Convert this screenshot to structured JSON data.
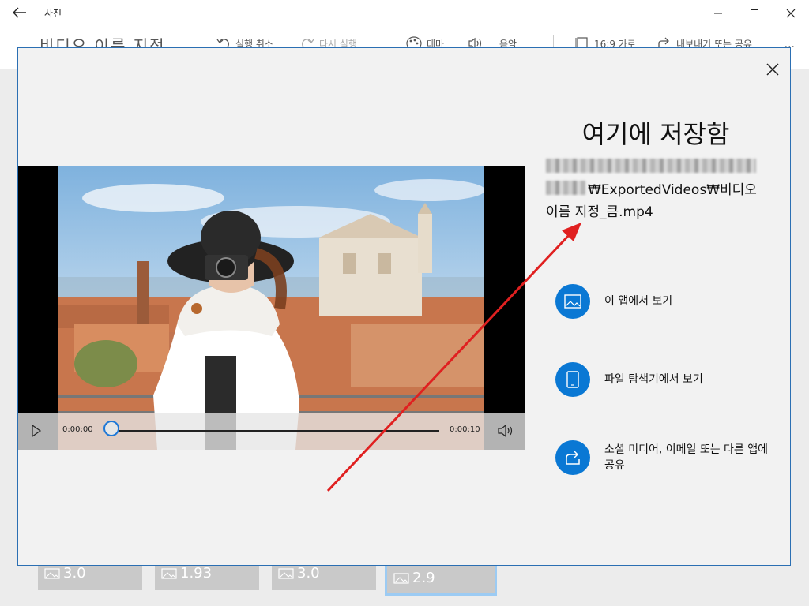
{
  "window": {
    "app_title": "사진",
    "controls": [
      "minimize",
      "maximize",
      "close"
    ]
  },
  "toolbar": {
    "document_title": "비디오 이름 지정",
    "undo_label": "실행 취소",
    "redo_label": "다시 실행",
    "theme_label": "테마",
    "music_label": "음악",
    "aspect_label": "16:9 가로",
    "export_label": "내보내기 또는 공유",
    "more_label": "..."
  },
  "thumbnails": [
    {
      "duration": "3.0",
      "selected": false
    },
    {
      "duration": "1.93",
      "selected": false
    },
    {
      "duration": "3.0",
      "selected": false
    },
    {
      "duration": "2.9",
      "selected": true
    }
  ],
  "dialog": {
    "heading": "여기에 저장함",
    "path_visible_line1": "₩ExportedVideos₩비디오",
    "path_visible_line2": "이름 지정_큼.mp4",
    "player": {
      "current_time": "0:00:00",
      "total_time": "0:00:10",
      "progress": 0.0
    },
    "actions": [
      {
        "label": "이 앱에서 보기",
        "icon": "image-icon"
      },
      {
        "label": "파일 탐색기에서 보기",
        "icon": "tablet-icon"
      },
      {
        "label": "소셜 미디어, 이메일 또는 다른 앱에 공유",
        "icon": "share-icon"
      }
    ]
  },
  "colors": {
    "accent": "#0a78d4",
    "dialog_bg": "#f2f2f2",
    "annotation_arrow": "#e02020",
    "dialog_border": "#2b6fb3"
  }
}
